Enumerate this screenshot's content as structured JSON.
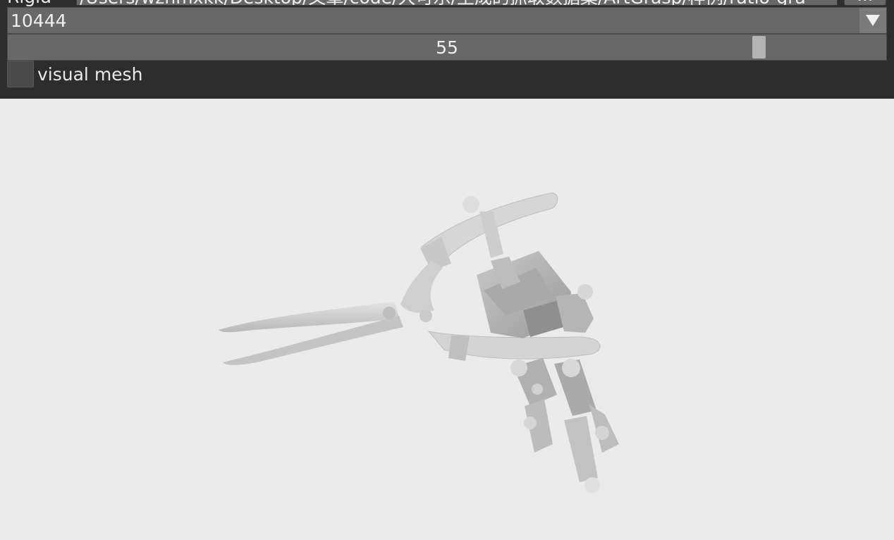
{
  "file": {
    "label": "Rigid",
    "path": "/Users/wzhmxkk/Desktop/文章/code/大可乐/生成的抓取数据集/ArtGrasp/样例/ratio-gra",
    "browse_label": "..."
  },
  "object_select": {
    "selected": "10444"
  },
  "frame_slider": {
    "value": "55",
    "fraction": 0.862
  },
  "visual_mesh": {
    "label": "visual mesh",
    "checked": false
  },
  "colors": {
    "panel_bg": "#2d2d2d",
    "widget_bg": "#686868",
    "viewport_bg": "#ebebeb",
    "mesh": "#c8c8c8"
  }
}
